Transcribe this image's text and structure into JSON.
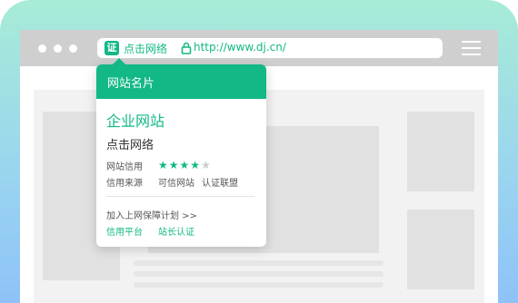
{
  "address_bar": {
    "badge": "证",
    "brand": "点击网络",
    "url": "http://www.dj.cn/"
  },
  "popup": {
    "title": "网站名片",
    "company": "企业网站",
    "brand": "点击网络",
    "credit_label": "网站信用",
    "credit_rating": 4,
    "credit_max": 5,
    "source_label": "信用来源",
    "source_values": [
      "可信网站",
      "认证联盟"
    ],
    "join_plan": "加入上网保障计划  >>",
    "links": [
      "信用平台",
      "站长认证"
    ]
  },
  "colors": {
    "accent": "#12b886",
    "topbar": "#cfcfcf",
    "placeholder": "#e1e1e1"
  },
  "icons": [
    "lock-icon",
    "hamburger-menu-icon",
    "window-dot-icon",
    "star-icon"
  ]
}
